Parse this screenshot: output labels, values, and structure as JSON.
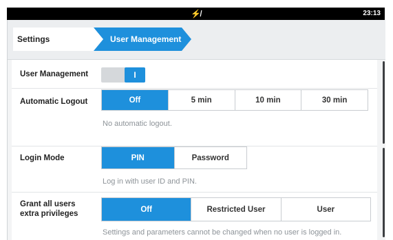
{
  "statusbar": {
    "center_icon": "no-network-icon",
    "center_glyph": "⚡̸",
    "time": "23:13"
  },
  "breadcrumb": {
    "items": [
      "Settings",
      "User Management"
    ],
    "active": 1
  },
  "rows": {
    "user_management": {
      "label": "User Management",
      "toggle_state": "on",
      "toggle_glyph": "I"
    },
    "automatic_logout": {
      "label": "Automatic Logout",
      "options": [
        "Off",
        "5 min",
        "10 min",
        "30 min"
      ],
      "selected": "Off",
      "description": "No automatic logout."
    },
    "login_mode": {
      "label": "Login Mode",
      "options": [
        "PIN",
        "Password"
      ],
      "selected": "PIN",
      "description": "Log in with user ID and PIN."
    },
    "grant_privileges": {
      "label_line1": "Grant all users",
      "label_line2": "extra privileges",
      "options": [
        "Off",
        "Restricted User",
        "User"
      ],
      "selected": "Off",
      "description": "Settings and parameters cannot be changed when no user is logged in."
    }
  },
  "colors": {
    "accent": "#1e90dc",
    "background": "#f3f4f5",
    "statusbar": "#000000"
  }
}
